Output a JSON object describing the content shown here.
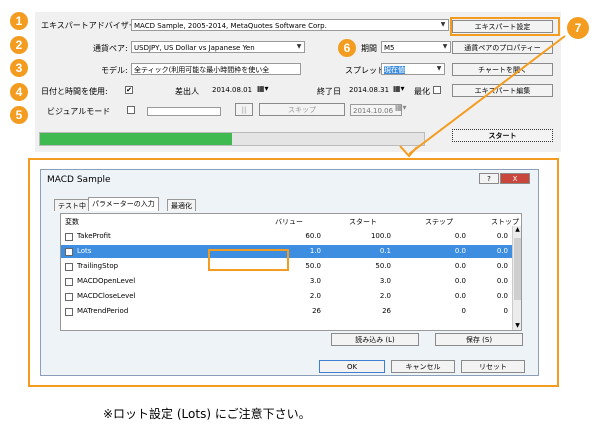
{
  "badges": [
    "1",
    "2",
    "3",
    "4",
    "5",
    "6",
    "7"
  ],
  "tester": {
    "expert_label": "エキスパートアドバイザー:",
    "expert_value": "MACD Sample, 2005-2014, MetaQuotes Software Corp.",
    "symbol_label": "通貨ペア:",
    "symbol_value": "USDJPY, US Dollar vs Japanese Yen",
    "model_label": "モデル:",
    "model_value": "全ティック(利用可能な最小時間枠を使い全",
    "use_date_label": "日付と時間を使用:",
    "from_label": "差出人",
    "from_value": "2014.08.01",
    "to_label": "終了日",
    "to_value": "2014.08.31",
    "optimization_label": "最化",
    "visual_label": "ビジュアルモード",
    "skip_label": "スキップ",
    "skip_date": "2014.10.06",
    "period_label": "期間",
    "period_value": "M5",
    "spread_label": "スプレッド",
    "spread_value": "現在値",
    "btn_expert_props": "エキスパート設定",
    "btn_symbol_props": "通貨ペアのプロパティー",
    "btn_open_chart": "チャートを開く",
    "btn_modify_expert": "エキスパート編集",
    "btn_start": "スタート",
    "progress_fraction": 0.5
  },
  "dialog": {
    "title": "MACD Sample",
    "help": "?",
    "close": "X",
    "tabs": [
      "テスト中",
      "パラメーターの入力",
      "最適化"
    ],
    "headers": [
      "変数",
      "バリュー",
      "スタート",
      "ステップ",
      "ストップ"
    ],
    "rows": [
      {
        "name": "TakeProfit",
        "value": "60.0",
        "start": "100.0",
        "step": "0.0",
        "stop": "0.0"
      },
      {
        "name": "Lots",
        "value": "1.0",
        "start": "0.1",
        "step": "0.0",
        "stop": "0.0"
      },
      {
        "name": "TrailingStop",
        "value": "50.0",
        "start": "50.0",
        "step": "0.0",
        "stop": "0.0"
      },
      {
        "name": "MACDOpenLevel",
        "value": "3.0",
        "start": "3.0",
        "step": "0.0",
        "stop": "0.0"
      },
      {
        "name": "MACDCloseLevel",
        "value": "2.0",
        "start": "2.0",
        "step": "0.0",
        "stop": "0.0"
      },
      {
        "name": "MATrendPeriod",
        "value": "26",
        "start": "26",
        "step": "0",
        "stop": "0"
      }
    ],
    "btn_load": "読み込み (L)",
    "btn_save": "保存 (S)",
    "btn_ok": "OK",
    "btn_cancel": "キャンセル",
    "btn_reset": "リセット"
  },
  "note": "※ロット設定 (Lots) にご注意下さい。"
}
